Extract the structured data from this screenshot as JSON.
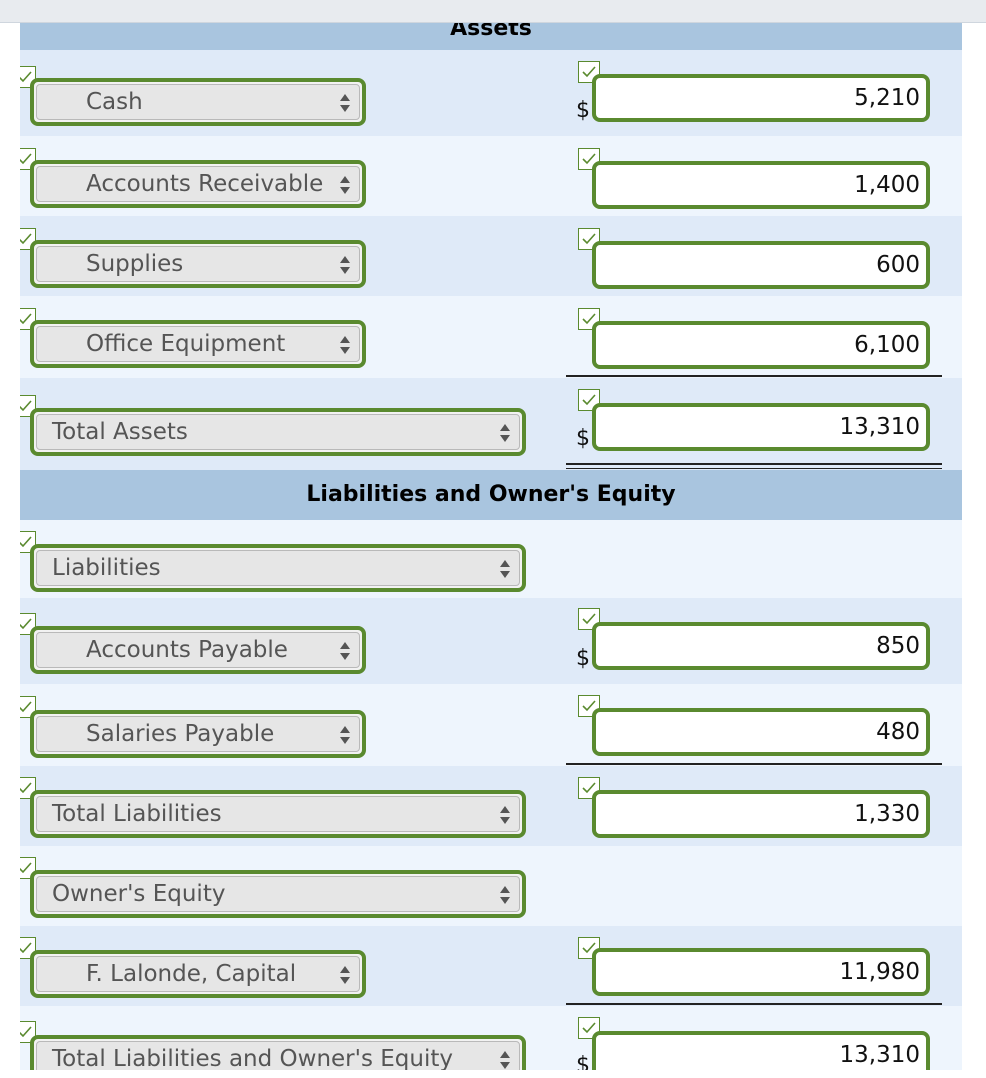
{
  "sections": {
    "assets_header": "Assets",
    "liabilities_header": "Liabilities and Owner's Equity"
  },
  "currency_symbol": "$",
  "rows": [
    {
      "label": "Cash",
      "value": "5,210"
    },
    {
      "label": "Accounts Receivable",
      "value": "1,400"
    },
    {
      "label": "Supplies",
      "value": "600"
    },
    {
      "label": "Office Equipment",
      "value": "6,100"
    },
    {
      "label": "Total Assets",
      "value": "13,310"
    },
    {
      "label": "Liabilities",
      "value": ""
    },
    {
      "label": "Accounts Payable",
      "value": "850"
    },
    {
      "label": "Salaries Payable",
      "value": "480"
    },
    {
      "label": "Total Liabilities",
      "value": "1,330"
    },
    {
      "label": "Owner's Equity",
      "value": ""
    },
    {
      "label": "F. Lalonde, Capital",
      "value": "11,980"
    },
    {
      "label": "Total Liabilities and Owner's Equity",
      "value": "13,310"
    }
  ],
  "colors": {
    "accent_green": "#5a8a2f",
    "header_blue": "#a9c5df",
    "band_dark": "#dfeaf8",
    "band_light": "#eef5fd"
  }
}
